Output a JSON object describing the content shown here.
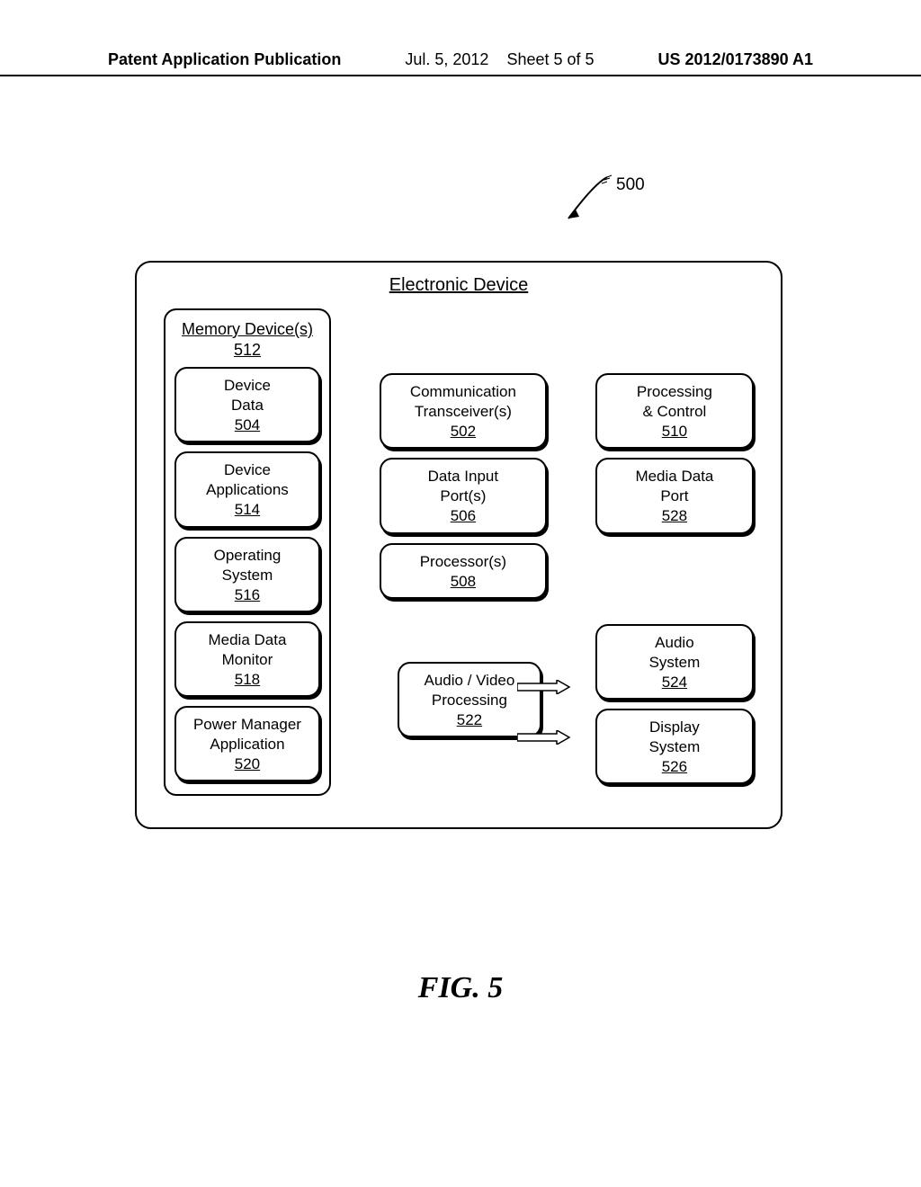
{
  "header": {
    "left": "Patent Application Publication",
    "mid_date": "Jul. 5, 2012",
    "mid_sheet": "Sheet 5 of 5",
    "right": "US 2012/0173890 A1"
  },
  "ref_num": "500",
  "device_title": "Electronic Device",
  "memory_title": "Memory Device(s)",
  "memory_num": "512",
  "memory_stack": [
    {
      "l1": "Device",
      "l2": "Data",
      "num": "504"
    },
    {
      "l1": "Device",
      "l2": "Applications",
      "num": "514"
    },
    {
      "l1": "Operating",
      "l2": "System",
      "num": "516"
    },
    {
      "l1": "Media Data",
      "l2": "Monitor",
      "num": "518"
    },
    {
      "l1": "Power Manager",
      "l2": "Application",
      "num": "520"
    }
  ],
  "col2_top": [
    {
      "l1": "Communication",
      "l2": "Transceiver(s)",
      "num": "502"
    },
    {
      "l1": "Data Input",
      "l2": "Port(s)",
      "num": "506"
    },
    {
      "l1": "Processor(s)",
      "l2": "",
      "num": "508"
    }
  ],
  "col2_bottom": {
    "l1": "Audio / Video",
    "l2": "Processing",
    "num": "522"
  },
  "col3_top": [
    {
      "l1": "Processing",
      "l2": "& Control",
      "num": "510"
    },
    {
      "l1": "Media Data",
      "l2": "Port",
      "num": "528"
    }
  ],
  "col3_bottom": [
    {
      "l1": "Audio",
      "l2": "System",
      "num": "524"
    },
    {
      "l1": "Display",
      "l2": "System",
      "num": "526"
    }
  ],
  "figure_caption": "FIG. 5",
  "chart_data": {
    "type": "diagram",
    "title": "Electronic Device block diagram (FIG. 5)",
    "reference_numeral": "500",
    "container": {
      "label": "Electronic Device"
    },
    "memory_device": {
      "label": "Memory Device(s)",
      "ref": "512",
      "contents": [
        {
          "label": "Device Data",
          "ref": "504"
        },
        {
          "label": "Device Applications",
          "ref": "514"
        },
        {
          "label": "Operating System",
          "ref": "516"
        },
        {
          "label": "Media Data Monitor",
          "ref": "518"
        },
        {
          "label": "Power Manager Application",
          "ref": "520"
        }
      ]
    },
    "blocks": [
      {
        "label": "Communication Transceiver(s)",
        "ref": "502"
      },
      {
        "label": "Data Input Port(s)",
        "ref": "506"
      },
      {
        "label": "Processor(s)",
        "ref": "508"
      },
      {
        "label": "Processing & Control",
        "ref": "510"
      },
      {
        "label": "Audio / Video Processing",
        "ref": "522"
      },
      {
        "label": "Audio System",
        "ref": "524"
      },
      {
        "label": "Display System",
        "ref": "526"
      },
      {
        "label": "Media Data Port",
        "ref": "528"
      }
    ],
    "connections": [
      {
        "from": "522",
        "to": "524",
        "style": "hollow-arrow"
      },
      {
        "from": "522",
        "to": "526",
        "style": "hollow-arrow"
      }
    ]
  }
}
